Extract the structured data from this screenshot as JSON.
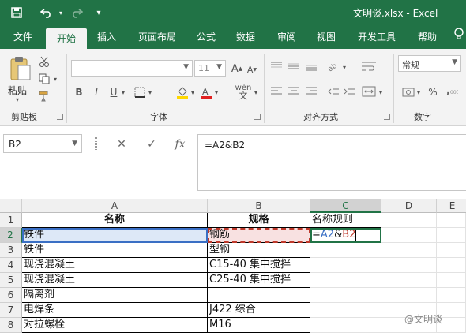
{
  "titlebar": {
    "document_title": "文明谈.xlsx  -  Excel",
    "quick_access": [
      "save-icon",
      "undo-icon",
      "redo-icon",
      "customize-icon"
    ]
  },
  "ribbon_tabs": [
    "文件",
    "开始",
    "插入",
    "页面布局",
    "公式",
    "数据",
    "审阅",
    "视图",
    "开发工具",
    "帮助"
  ],
  "active_tab": "开始",
  "ribbon": {
    "clipboard": {
      "paste_label": "粘贴",
      "group_label": "剪贴板"
    },
    "font": {
      "font_name": "",
      "font_size": "11",
      "bold": "B",
      "italic": "I",
      "underline": "U",
      "phonetic": "wén",
      "group_label": "字体"
    },
    "alignment": {
      "group_label": "对齐方式"
    },
    "number": {
      "format": "常规",
      "percent": "%",
      "group_label": "数字"
    }
  },
  "formula_bar": {
    "name_box": "B2",
    "cancel_icon": "✕",
    "enter_icon": "✓",
    "fx_label": "fx",
    "formula": "=A2&B2"
  },
  "sheet": {
    "columns": [
      "A",
      "B",
      "C",
      "D",
      "E"
    ],
    "selected_column": "C",
    "rows": [
      "1",
      "2",
      "3",
      "4",
      "5",
      "6",
      "7",
      "8"
    ],
    "selected_row": "2",
    "cells": {
      "A1": "名称",
      "B1": "规格",
      "C1": "名称规则",
      "A2": "铁件",
      "B2": "钢筋",
      "A3": "铁件",
      "B3": "型钢",
      "A4": "现浇混凝土",
      "B4": "C15-40 集中搅拌",
      "A5": "现浇混凝土",
      "B5": "C25-40 集中搅拌",
      "A6": "隔离剂",
      "B6": "",
      "A7": "电焊条",
      "B7": "J422 综合",
      "A8": "对拉螺栓",
      "B8": "M16"
    },
    "edit_cell": {
      "address": "C2",
      "prefix": "=",
      "ref1": "A2",
      "amp": "&",
      "ref2": "B2"
    }
  },
  "watermark": "@文明谈",
  "colors": {
    "excel_green": "#217346",
    "ref_blue": "#3a6fc4",
    "ref_red": "#c0392b"
  }
}
